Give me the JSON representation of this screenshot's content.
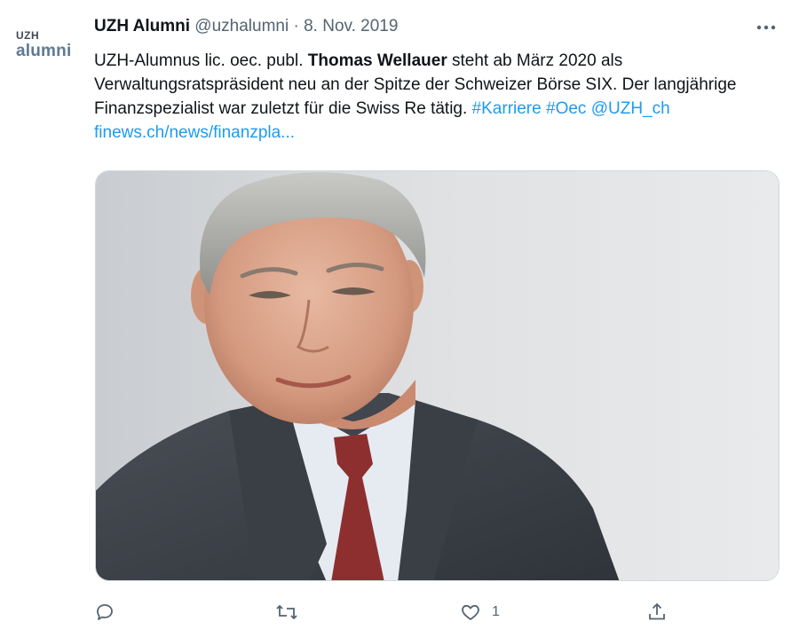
{
  "account": {
    "avatar_line1": "UZH",
    "avatar_line2": "alumni",
    "display_name": "UZH Alumni",
    "handle": "@uzhalumni",
    "separator": "·",
    "date": "8. Nov. 2019"
  },
  "tweet": {
    "text_1": "UZH-Alumnus lic. oec. publ. ",
    "bold_name": "Thomas Wellauer",
    "text_2": " steht ab März 2020 als Verwaltungsratspräsident neu an der Spitze der Schweizer Börse SIX. Der langjährige Finanzspezialist war zuletzt für die Swiss Re tätig. ",
    "hashtag_1": "#Karriere",
    "hashtag_2": "#Oec",
    "mention": "@UZH_ch",
    "link": "finews.ch/news/finanzpla..."
  },
  "actions": {
    "reply_icon": "reply-icon",
    "retweet_icon": "retweet-icon",
    "like_icon": "heart-icon",
    "like_count": "1",
    "share_icon": "share-icon"
  },
  "colors": {
    "link": "#1d9bf0",
    "muted": "#536471",
    "text": "#0f1419"
  }
}
